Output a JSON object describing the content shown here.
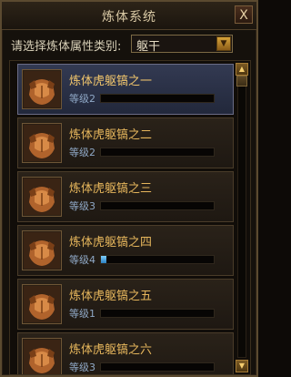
{
  "window": {
    "title": "炼体系统",
    "close_glyph": "X"
  },
  "filter": {
    "label": "请选择炼体属性类别:",
    "selected": "躯干",
    "dropdown_glyph": "▼"
  },
  "items": [
    {
      "name": "炼体虎躯镐之一",
      "level": "等级2",
      "progress": 0.0,
      "selected": true
    },
    {
      "name": "炼体虎躯镐之二",
      "level": "等级2",
      "progress": 0.0
    },
    {
      "name": "炼体虎躯镐之三",
      "level": "等级3",
      "progress": 0.0
    },
    {
      "name": "炼体虎躯镐之四",
      "level": "等级4",
      "progress": 0.05
    },
    {
      "name": "炼体虎躯镐之五",
      "level": "等级1",
      "progress": 0.0
    },
    {
      "name": "炼体虎躯镐之六",
      "level": "等级3",
      "progress": 0.0
    }
  ],
  "scrollbar": {
    "up_glyph": "▲",
    "down_glyph": "▼"
  },
  "icons": {
    "item_icon": "armored-torso-icon"
  }
}
